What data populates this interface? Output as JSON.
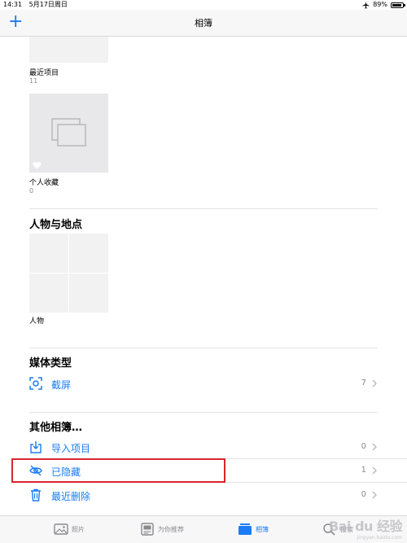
{
  "status_bar": {
    "time": "14:31",
    "date": "5月17日周日",
    "airplane_icon": "airplane-icon",
    "battery_pct": "89%",
    "battery_level": 0.89
  },
  "nav": {
    "title": "相簿",
    "add_label": "+"
  },
  "my_albums": [
    {
      "name": "最近项目",
      "count": "11"
    },
    {
      "name": "个人收藏",
      "count": "0"
    }
  ],
  "people_section": {
    "title": "人物与地点",
    "album_name": "人物"
  },
  "media_types": {
    "title": "媒体类型",
    "items": [
      {
        "label": "截屏",
        "count": "7",
        "icon": "screenshot-icon"
      }
    ]
  },
  "other_albums": {
    "title": "其他相簿…",
    "items": [
      {
        "label": "导入项目",
        "count": "0",
        "icon": "import-icon"
      },
      {
        "label": "已隐藏",
        "count": "1",
        "icon": "eye-slash-icon"
      },
      {
        "label": "最近删除",
        "count": "0",
        "icon": "trash-icon"
      }
    ]
  },
  "tabbar": {
    "tabs": [
      {
        "label": "照片",
        "icon": "photos-icon",
        "active": false
      },
      {
        "label": "为你推荐",
        "icon": "for-you-icon",
        "active": false
      },
      {
        "label": "相簿",
        "icon": "albums-icon",
        "active": true
      },
      {
        "label": "搜索",
        "icon": "search-icon",
        "active": false
      }
    ]
  },
  "colors": {
    "accent": "#1a7cf4",
    "annotation_box": "#d8272c"
  },
  "watermark": {
    "main": "Bai du 经验",
    "sub": "jingyan.baidu.com"
  }
}
